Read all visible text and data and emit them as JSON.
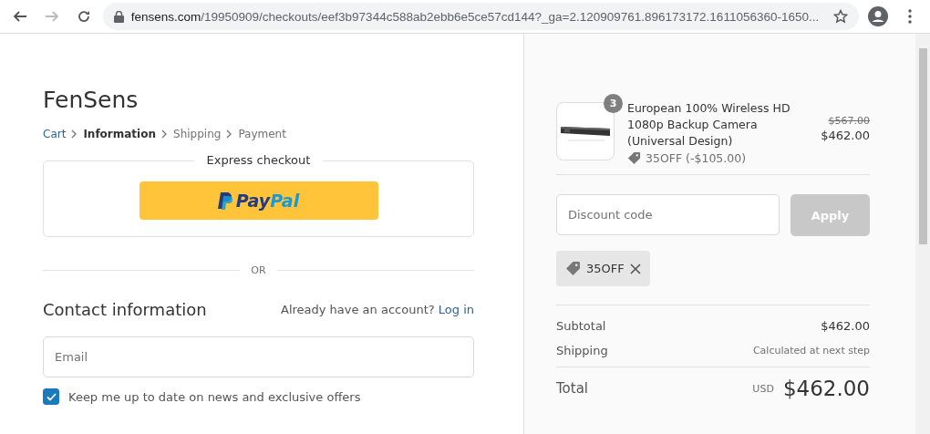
{
  "browser": {
    "url_domain": "fensens.com",
    "url_path": "/19950909/checkouts/eef3b97344c588ab2ebb6e5ce57cd144?_ga=2.120909761.896173172.1611056360-1650...",
    "forward_disabled": true
  },
  "store": {
    "name": "FenSens"
  },
  "breadcrumb": [
    {
      "label": "Cart",
      "kind": "link"
    },
    {
      "label": "Information",
      "kind": "current"
    },
    {
      "label": "Shipping",
      "kind": "upcoming"
    },
    {
      "label": "Payment",
      "kind": "upcoming"
    }
  ],
  "express": {
    "title": "Express checkout",
    "paypal_parts": [
      "Pay",
      "Pal"
    ]
  },
  "divider": "OR",
  "contact": {
    "title": "Contact information",
    "account_prompt": "Already have an account?",
    "login": "Log in",
    "email_placeholder": "Email",
    "newsletter": {
      "label": "Keep me up to date on news and exclusive offers",
      "checked": true
    }
  },
  "order": {
    "item": {
      "quantity": "3",
      "name": "European 100% Wireless HD 1080p Backup Camera (Universal Design)",
      "discount": "35OFF (-$105.00)",
      "original_price": "$567.00",
      "price": "$462.00"
    },
    "discount_placeholder": "Discount code",
    "apply": {
      "label": "Apply",
      "disabled": true
    },
    "applied_code": "35OFF",
    "subtotal": {
      "label": "Subtotal",
      "value": "$462.00"
    },
    "shipping": {
      "label": "Shipping",
      "value": "Calculated at next step"
    },
    "total": {
      "label": "Total",
      "currency": "USD",
      "value": "$462.00"
    }
  }
}
